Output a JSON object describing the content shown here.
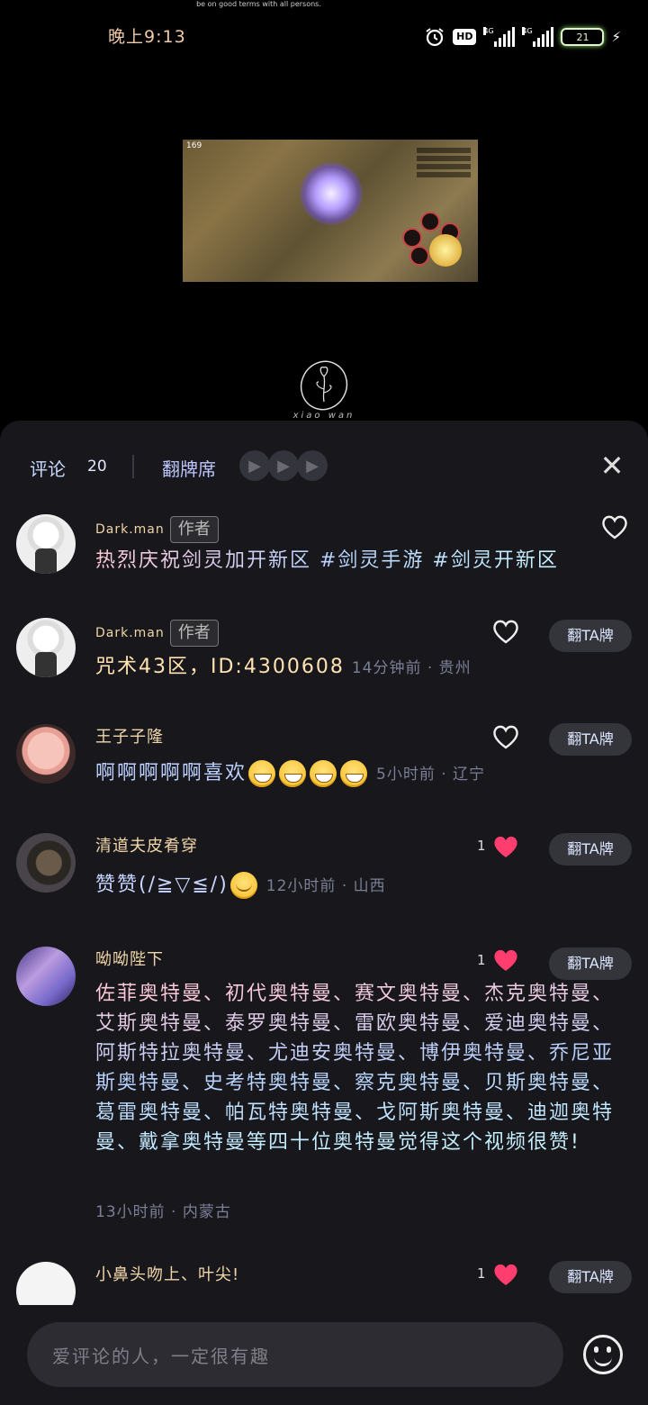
{
  "top_note": "be on good terms with all persons.",
  "status_bar": {
    "time": "晚上9:13",
    "hd_label": "HD",
    "net1": "4G",
    "net2": "4G",
    "battery": "21"
  },
  "video": {
    "hud_level": "169"
  },
  "logo_text": "xiao wan",
  "header": {
    "comments_label": "评论",
    "comments_count": "20",
    "flip_seat_label": "翻牌席"
  },
  "comments": [
    {
      "username": "Dark.man",
      "author_tag": "作者",
      "text": "热烈庆祝剑灵加开新区 #剑灵手游 #剑灵开新区",
      "meta": "",
      "likes": "",
      "liked": false,
      "flip_label": ""
    },
    {
      "username": "Dark.man",
      "author_tag": "作者",
      "text": "咒术43区，ID:4300608",
      "meta": "14分钟前 · 贵州",
      "likes": "",
      "liked": false,
      "flip_label": "翻TA牌"
    },
    {
      "username": "王子子隆",
      "text": "啊啊啊啊啊喜欢",
      "meta": "5小时前 · 辽宁",
      "likes": "",
      "liked": false,
      "flip_label": "翻TA牌"
    },
    {
      "username": "清道夫皮肴穿",
      "text": "赞赞(/≧▽≦/)",
      "meta": "12小时前 · 山西",
      "likes": "1",
      "liked": true,
      "flip_label": "翻TA牌"
    },
    {
      "username": "呦呦陛下",
      "text": "佐菲奥特曼、初代奥特曼、赛文奥特曼、杰克奥特曼、艾斯奥特曼、泰罗奥特曼、雷欧奥特曼、爱迪奥特曼、阿斯特拉奥特曼、尤迪安奥特曼、博伊奥特曼、乔尼亚斯奥特曼、史考特奥特曼、察克奥特曼、贝斯奥特曼、葛雷奥特曼、帕瓦特奥特曼、戈阿斯奥特曼、迪迦奥特曼、戴拿奥特曼等四十位奥特曼觉得这个视频很赞!",
      "meta": "13小时前 · 内蒙古",
      "likes": "1",
      "liked": true,
      "flip_label": "翻TA牌"
    },
    {
      "username": "小鼻头吻上、叶尖!",
      "text": "",
      "meta": "",
      "likes": "1",
      "liked": true,
      "flip_label": "翻TA牌"
    }
  ],
  "input": {
    "placeholder": "爱评论的人，一定很有趣"
  },
  "colors": {
    "sheet_bg": "#17171c",
    "heart_liked": "#ff3d6e",
    "username": "#f0d6a8"
  }
}
